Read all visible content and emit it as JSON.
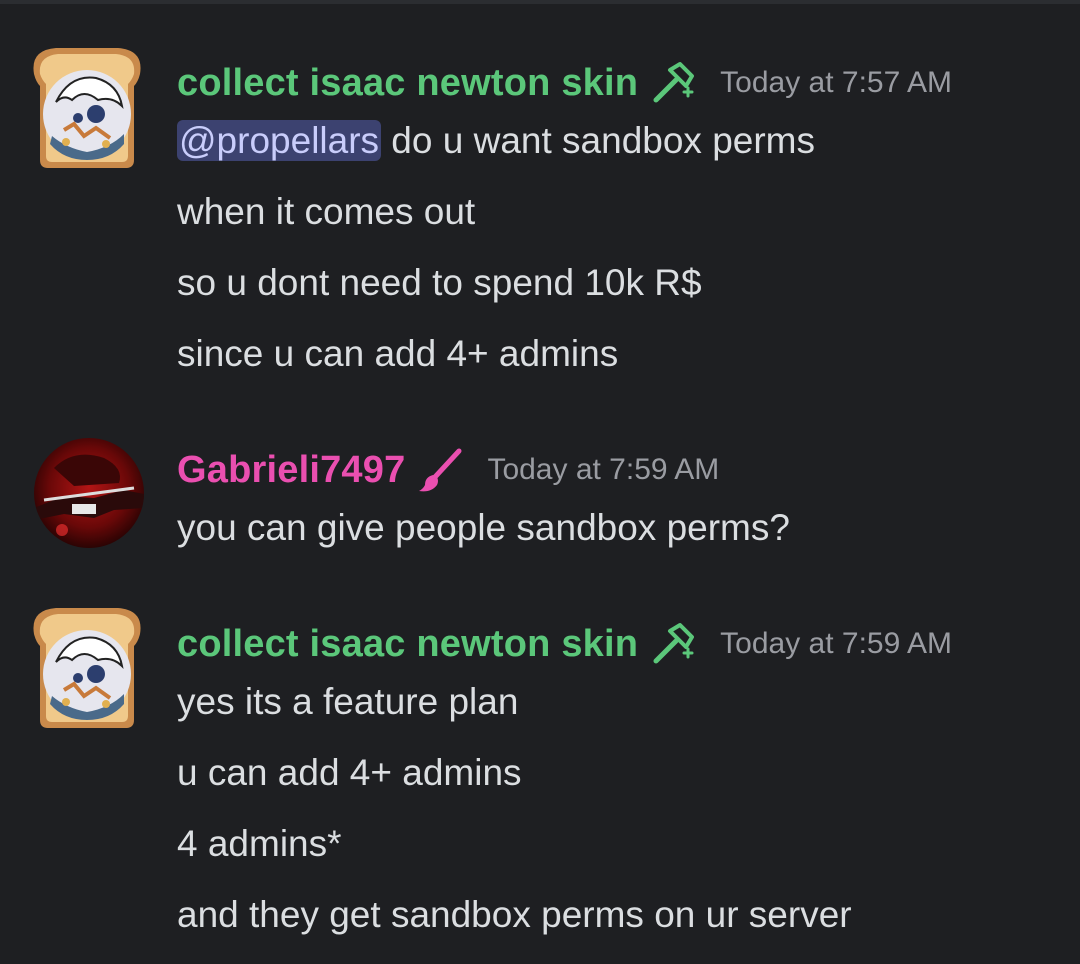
{
  "colors": {
    "background": "#1e1f22",
    "green_role": "#5bc77a",
    "pink_role": "#ea4fb0",
    "timestamp": "#9a9ca2",
    "message_text": "#dbdee1",
    "mention_bg": "#3c4270",
    "mention_text": "#c9cdfb"
  },
  "messages": [
    {
      "username": "collect isaac newton skin",
      "role_icon": "hammer-icon",
      "timestamp": "Today at 7:57 AM",
      "mention": "@propellars",
      "first_line_rest": " do u want sandbox perms",
      "lines": [
        "when it comes out",
        "so u dont need to spend 10k R$",
        "since u can add 4+ admins"
      ]
    },
    {
      "username": "Gabrieli7497",
      "role_icon": "paintbrush-icon",
      "timestamp": "Today at 7:59 AM",
      "lines": [
        "you can give people sandbox perms?"
      ]
    },
    {
      "username": "collect isaac newton skin",
      "role_icon": "hammer-icon",
      "timestamp": "Today at 7:59 AM",
      "lines": [
        "yes its a feature plan",
        "u can add 4+ admins",
        "4 admins*",
        "and they get sandbox perms on ur server"
      ]
    }
  ]
}
